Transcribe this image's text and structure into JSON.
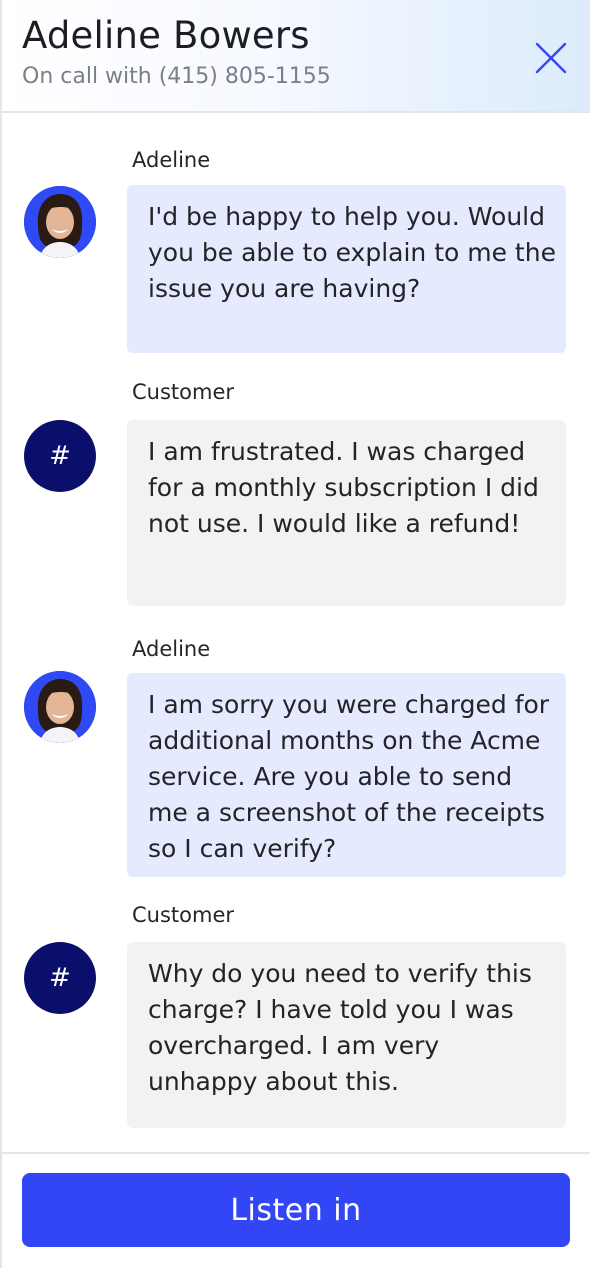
{
  "header": {
    "title": "Adeline Bowers",
    "subtitle": "On call with (415) 805-1155",
    "close_icon": "close-icon"
  },
  "messages": [
    {
      "sender": "Adeline",
      "role": "agent",
      "avatar": "agent-photo",
      "text": "I'd be happy to help you. Would you be able to explain to me the issue you are having?"
    },
    {
      "sender": "Customer",
      "role": "customer",
      "avatar": "#",
      "text": "I am frustrated. I was charged for a monthly subscription I did not use. I would like a refund!"
    },
    {
      "sender": "Adeline",
      "role": "agent",
      "avatar": "agent-photo",
      "text": "I am sorry you were charged for additional months on the Acme service. Are you able to send me a screenshot of the receipts so I can verify?"
    },
    {
      "sender": "Customer",
      "role": "customer",
      "avatar": "#",
      "text": "Why do you need to verify this charge? I have told you I was overcharged. I am very unhappy about this."
    }
  ],
  "footer": {
    "listen_label": "Listen in"
  },
  "colors": {
    "accent": "#3346f5",
    "agent_bubble": "#e6eafe",
    "customer_bubble": "#f2f2f3",
    "customer_avatar": "#0a0f6b",
    "agent_avatar_bg": "#2f49f5"
  }
}
